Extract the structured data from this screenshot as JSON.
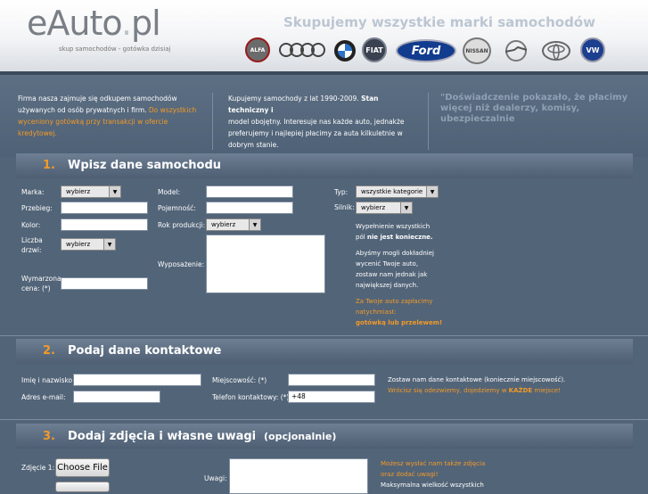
{
  "header": {
    "logo_main": "eAuto",
    "logo_dot": ".",
    "logo_tld": "pl",
    "tagline": "skup samochodów - gotówka dzisiaj",
    "headline": "Skupujemy wszystkie marki samochodów",
    "brands": [
      {
        "name": "Alfa Romeo",
        "label": "ALFA"
      },
      {
        "name": "Audi",
        "label": "OOOO"
      },
      {
        "name": "BMW",
        "label": "BMW"
      },
      {
        "name": "Fiat",
        "label": "FIAT"
      },
      {
        "name": "Ford",
        "label": "Ford"
      },
      {
        "name": "Nissan",
        "label": "NISSAN"
      },
      {
        "name": "Opel",
        "label": "OPEL"
      },
      {
        "name": "Toyota",
        "label": "TOYOTA"
      },
      {
        "name": "Volkswagen",
        "label": "VW"
      }
    ]
  },
  "intro": {
    "col1_lines": [
      "Firma nasza zajmuje się odkupem samochodów",
      "używanych od osób prywatnych i firm."
    ],
    "col1_orange": [
      "Do wszystkich",
      "wyceniony gotówką przy transakcji w ofercie",
      "kredytowej."
    ],
    "col2_lines": [
      "Kupujemy samochody z lat 1990-2009.",
      "model obojętny. Interesuje nas każde auto, jednakże",
      "preferujemy i najlepiej płacimy za auta kilkuletnie w",
      "dobrym stanie."
    ],
    "col2_bold": "Stan techniczny i",
    "quote_lines": [
      "\"Doświadczenie pokazało, że płacimy",
      "więcej niż dealerzy, komisy,",
      "ubezpieczalnie"
    ]
  },
  "section1": {
    "num": "1.",
    "title": "Wpisz dane samochodu",
    "labels": {
      "marka": "Marka:",
      "przebieg": "Przebieg:",
      "kolor": "Kolor:",
      "drzwi1": "Liczba",
      "drzwi2": "drzwi:",
      "cena1": "Wymarzona",
      "cena2": "cena: (*)",
      "model": "Model:",
      "pojemnosc": "Pojemność:",
      "rok": "Rok produkcji:",
      "wyposazenie": "Wyposażenie:",
      "typ": "Typ:",
      "silnik": "Silnik:"
    },
    "selects": {
      "marka": "wybierz",
      "drzwi": "wybierz",
      "rok": "wybierz",
      "typ": "wszystkie kategorie",
      "silnik": "wybierz"
    },
    "note_lines": [
      "Wypełnienie wszystkich",
      "pól"
    ],
    "note_bold": "nie jest konieczne.",
    "note2_lines": [
      "Abyśmy mogli dokładniej",
      "wycenić Twoje auto,",
      "zostaw nam jednak jak",
      "największej danych."
    ],
    "orange_lines": [
      "Za Twoje auto zapłacimy",
      "natychmiast:",
      "gotówką lub przelewem!"
    ]
  },
  "section2": {
    "num": "2.",
    "title": "Podaj dane kontaktowe",
    "labels": {
      "imie": "Imię i nazwisko:",
      "email": "Adres e-mail:",
      "miejscowosc": "Miejscowość: (*)",
      "telefon": "Telefon kontaktowy: (*)"
    },
    "phone_value": "+48",
    "note": "Zostaw nam dane kontaktowe (koniecznie miejscowość).",
    "orange_note": "Wrócisz się odezwiemy, dojedziemy w",
    "orange_bold": "KAŻDE",
    "orange_tail": "miejsce!"
  },
  "section3": {
    "num": "3.",
    "title": "Dodaj zdjęcia i własne uwagi",
    "optional": "(opcjonalnie)",
    "photo_label": "Zdjęcie 1:",
    "file_button": "Choose File",
    "uwagi_label": "Uwagi:",
    "orange_lines": [
      "Możesz wysłać nam także zdjęcia",
      "oraz dodać uwagi!"
    ],
    "cut_line": "Maksymalna wielkość wszystkich"
  },
  "colors": {
    "accent": "#f29a28",
    "background": "#526478"
  }
}
